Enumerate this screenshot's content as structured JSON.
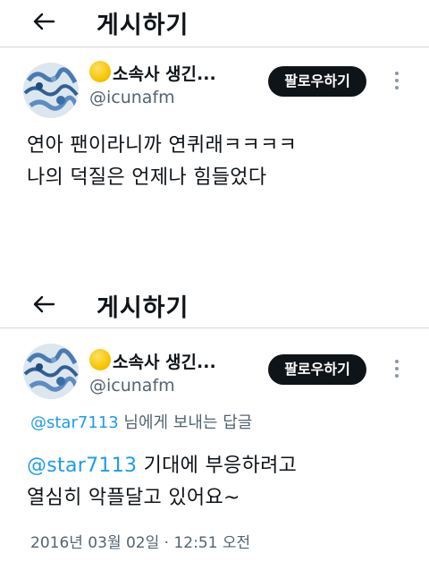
{
  "screens": [
    {
      "header": {
        "title": "게시하기"
      },
      "author": {
        "display_name": "소속사 생긴...",
        "handle": "@icunafm"
      },
      "follow_label": "팔로우하기",
      "tweet_lines": [
        "연아 팬이라니까 연퀴래ㅋㅋㅋㅋ",
        "나의 덕질은 언제나 힘들었다"
      ]
    },
    {
      "header": {
        "title": "게시하기"
      },
      "author": {
        "display_name": "소속사 생긴...",
        "handle": "@icunafm"
      },
      "follow_label": "팔로우하기",
      "reply_to": {
        "mention": "@star7113",
        "suffix": " 님에게 보내는 답글"
      },
      "tweet": {
        "mention": "@star7113",
        "line1_rest": " 기대에 부응하려고",
        "line2": "열심히 악플달고 있어요~"
      },
      "timestamp": "2016년 03월 02일 · 12:51 오전"
    }
  ],
  "colors": {
    "text": "#0f1419",
    "secondary": "#536471",
    "link": "#1d9bf0",
    "button_bg": "#0f1419",
    "button_text": "#ffffff"
  },
  "icons": [
    "back-arrow-icon",
    "sun-emoji-icon",
    "more-options-icon"
  ]
}
